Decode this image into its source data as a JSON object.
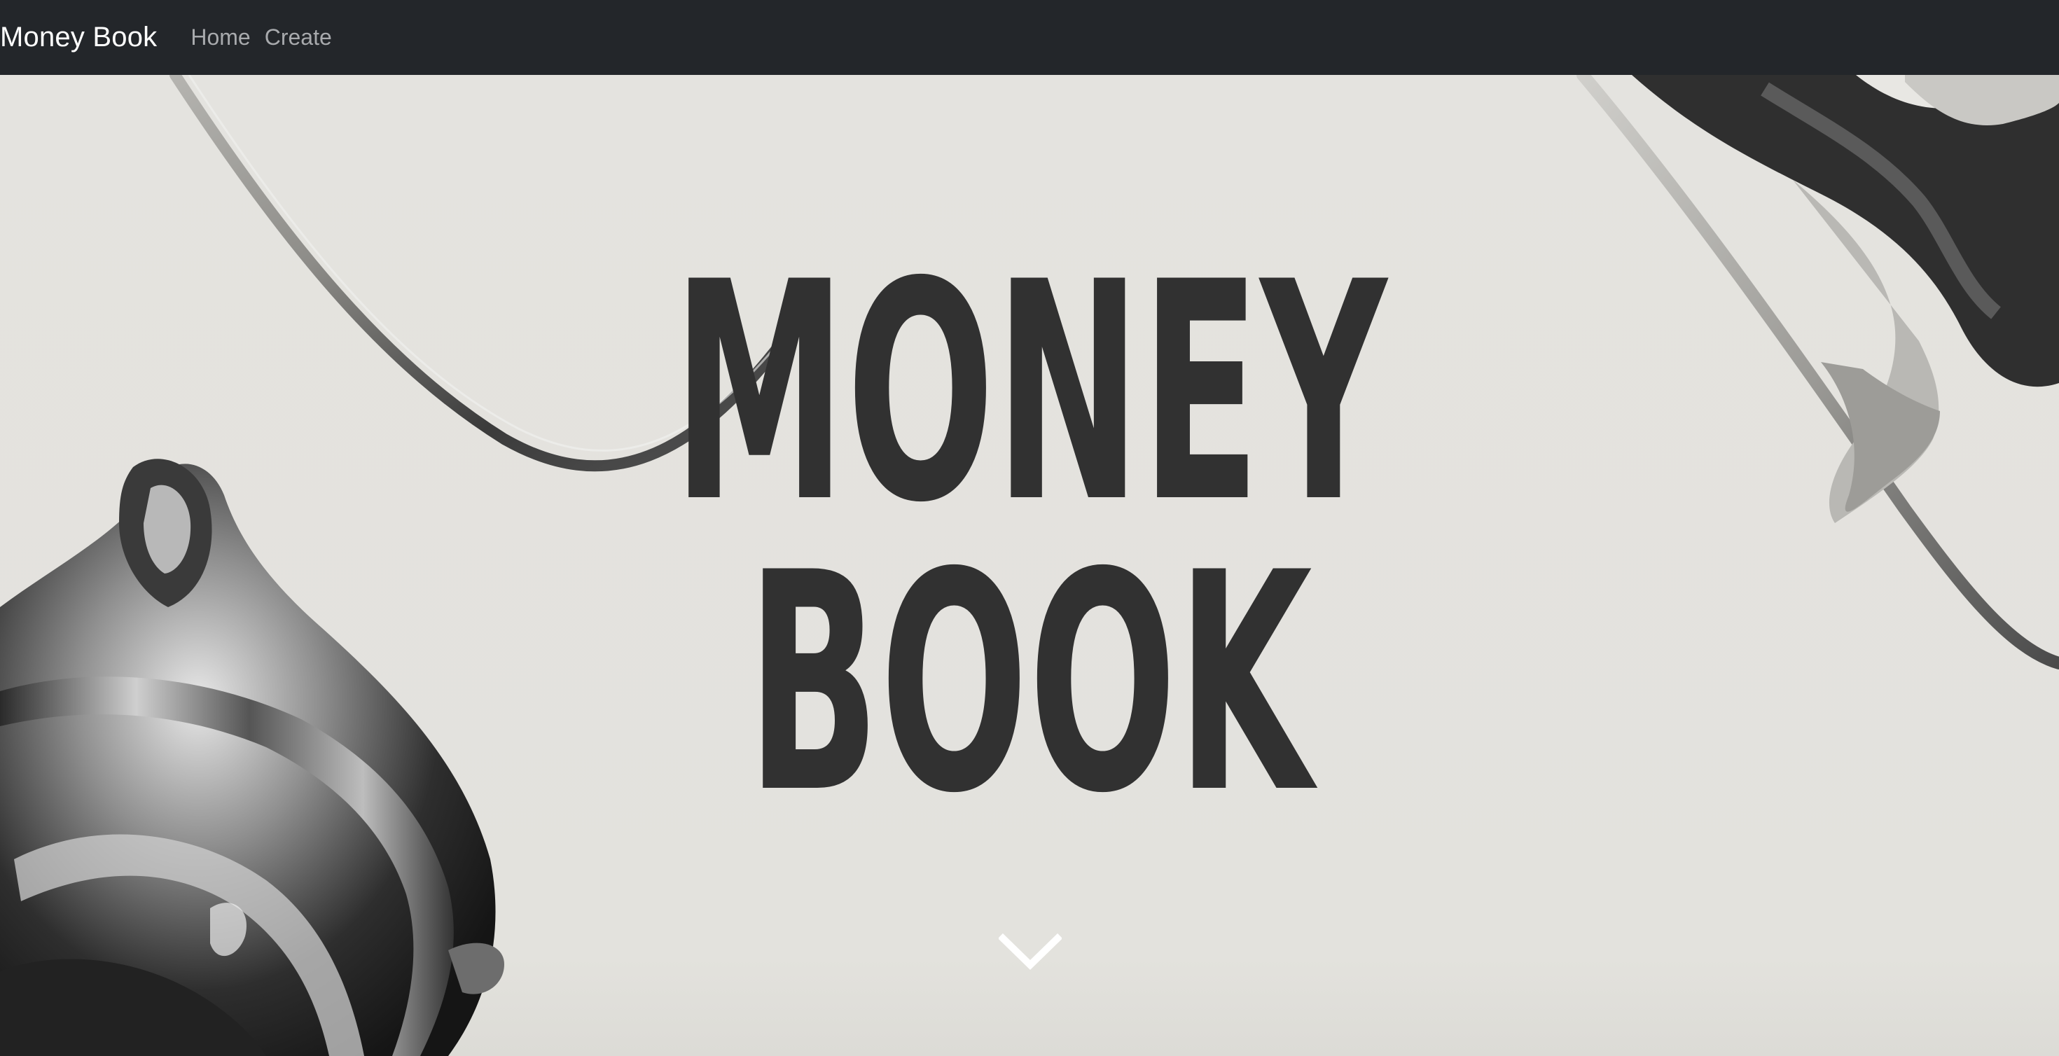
{
  "navbar": {
    "brand": "Money Book",
    "links": [
      {
        "label": "Home"
      },
      {
        "label": "Create"
      }
    ]
  },
  "hero": {
    "title_line1": "MONEY",
    "title_line2": "BOOK",
    "scroll_icon": "chevron-down-icon"
  },
  "colors": {
    "navbar_bg": "#23262a",
    "hero_bg": "#e4e3df",
    "title": "#313131",
    "nav_link": "#a8aaad",
    "brand": "#ffffff"
  }
}
